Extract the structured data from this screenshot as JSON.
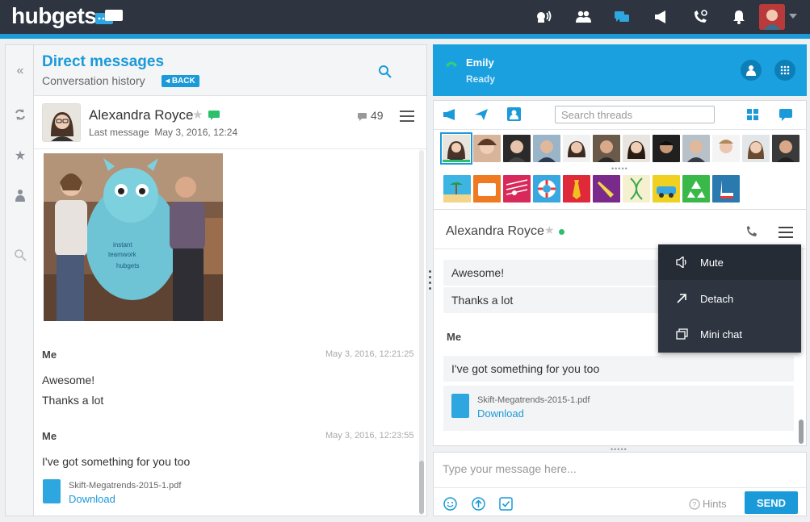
{
  "topbar": {
    "logo": "hubgets",
    "icons": [
      "voice-icon",
      "team-icon",
      "chat-icon",
      "megaphone-icon",
      "phone-settings-icon",
      "bell-icon"
    ],
    "colors": {
      "bar": "#2e3540",
      "accent": "#1a9ad8"
    }
  },
  "direct_messages": {
    "title": "Direct messages",
    "subtitle": "Conversation history",
    "back_label": "BACK"
  },
  "conversation": {
    "name": "Alexandra Royce",
    "last_message_label": "Last message",
    "last_message_time": "May 3, 2016, 12:24",
    "message_count": "49"
  },
  "history": [
    {
      "sender": "Me",
      "time": "May 3, 2016, 12:21:25",
      "lines": [
        "Awesome!",
        "Thanks a lot"
      ]
    },
    {
      "sender": "Me",
      "time": "May 3, 2016, 12:23:55",
      "lines": [
        "I've got something for you too"
      ],
      "file": {
        "name": "Skift-Megatrends-2015-1.pdf",
        "action": "Download"
      }
    }
  ],
  "call": {
    "name": "Emily",
    "status": "Ready"
  },
  "threads": {
    "search_placeholder": "Search threads"
  },
  "chat": {
    "name": "Alexandra Royce",
    "messages": [
      "Awesome!",
      "Thanks a lot"
    ],
    "sender": "Me",
    "message": "I've got something for you too",
    "file": {
      "name": "Skift-Megatrends-2015-1.pdf",
      "action": "Download"
    }
  },
  "menu": {
    "items": [
      {
        "label": "Mute",
        "icon": "speaker-icon"
      },
      {
        "label": "Detach",
        "icon": "arrow-out-icon"
      },
      {
        "label": "Mini chat",
        "icon": "windows-icon"
      }
    ]
  },
  "compose": {
    "placeholder": "Type your message here...",
    "hints_label": "Hints",
    "send_label": "SEND"
  }
}
